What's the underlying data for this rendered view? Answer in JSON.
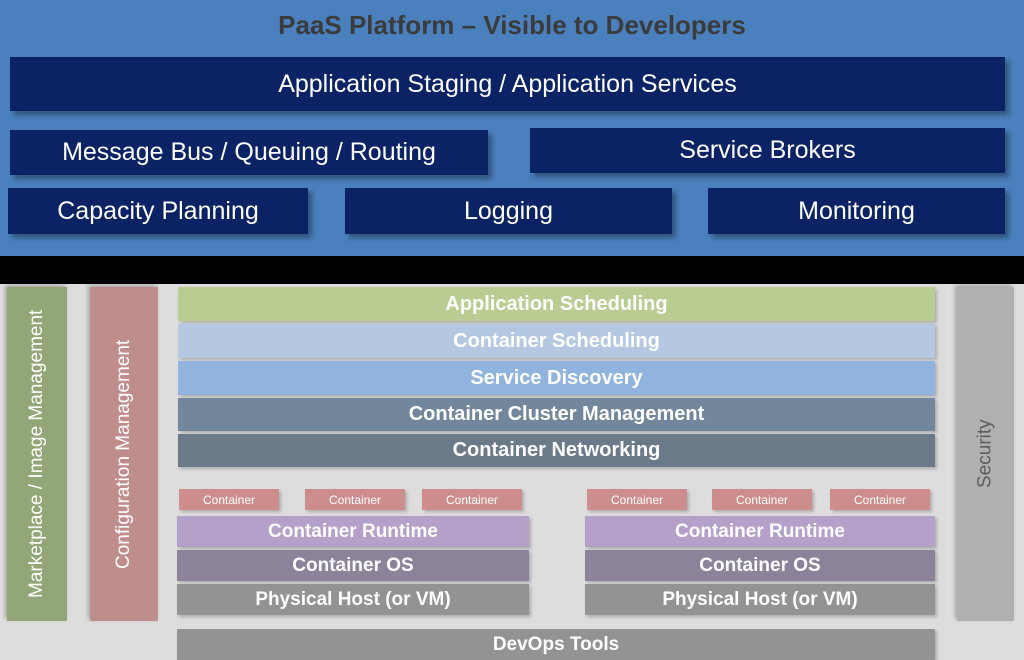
{
  "paas": {
    "title": "PaaS Platform – Visible to Developers",
    "background_color": "#4a80bd",
    "box_color": "#0b2265",
    "title_color": "#3b3b3b",
    "boxes": [
      {
        "label": "Application Staging / Application Services"
      },
      {
        "label": "Message Bus / Queuing / Routing"
      },
      {
        "label": "Service Brokers"
      },
      {
        "label": "Capacity Planning"
      },
      {
        "label": "Logging"
      },
      {
        "label": "Monitoring"
      }
    ]
  },
  "infra": {
    "background_color": "#dddddd",
    "pillars": [
      {
        "label": "Marketplace / Image Management",
        "color": "#93a677"
      },
      {
        "label": "Configuration Management",
        "color": "#c08d8d"
      },
      {
        "label": "Security",
        "color": "#b0b0b0"
      }
    ],
    "service_rows": [
      {
        "label": "Application Scheduling",
        "color": "#b9cd93"
      },
      {
        "label": "Container Scheduling",
        "color": "#b4c8e2"
      },
      {
        "label": "Service Discovery",
        "color": "#91b4de"
      },
      {
        "label": "Container Cluster Management",
        "color": "#73879c"
      },
      {
        "label": "Container Networking",
        "color": "#6a7a89"
      }
    ],
    "host_groups": [
      {
        "containers": [
          "Container",
          "Container",
          "Container"
        ],
        "layers": [
          {
            "label": "Container Runtime",
            "color": "#b4a0c8"
          },
          {
            "label": "Container OS",
            "color": "#8c8299"
          },
          {
            "label": "Physical Host (or VM)",
            "color": "#939393"
          }
        ]
      },
      {
        "containers": [
          "Container",
          "Container",
          "Container"
        ],
        "layers": [
          {
            "label": "Container Runtime",
            "color": "#b4a0c8"
          },
          {
            "label": "Container OS",
            "color": "#8c8299"
          },
          {
            "label": "Physical Host (or VM)",
            "color": "#939393"
          }
        ]
      }
    ],
    "devops": {
      "label": "DevOps Tools",
      "color": "#939393"
    }
  }
}
